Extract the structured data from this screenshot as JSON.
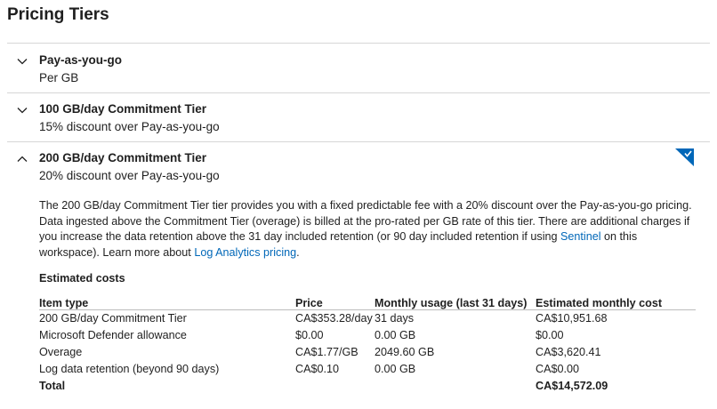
{
  "page": {
    "title": "Pricing Tiers"
  },
  "tiers": [
    {
      "name": "Pay-as-you-go",
      "subtitle": "Per GB",
      "expanded": false,
      "chevron": "chevron-down-icon"
    },
    {
      "name": "100 GB/day Commitment Tier",
      "subtitle": "15% discount over Pay-as-you-go",
      "expanded": false,
      "chevron": "chevron-down-icon"
    },
    {
      "name": "200 GB/day Commitment Tier",
      "subtitle": "20% discount over Pay-as-you-go",
      "expanded": true,
      "selected": true,
      "chevron": "chevron-up-icon"
    }
  ],
  "selected_tier": {
    "description": {
      "part1": "The 200 GB/day Commitment Tier tier provides you with a fixed predictable fee with a 20% discount over the Pay-as-you-go pricing. Data ingested above the Commitment Tier (overage) is billed at the pro-rated per GB rate of this tier. There are additional charges if you increase the data retention above the 31 day included retention (or 90 day included retention if using ",
      "sentinel_link": "Sentinel",
      "part2": " on this workspace). Learn more about ",
      "pricing_link": "Log Analytics pricing",
      "part3": "."
    },
    "estimated_costs": {
      "title": "Estimated costs",
      "headers": [
        "Item type",
        "Price",
        "Monthly usage (last 31 days)",
        "Estimated monthly cost"
      ],
      "rows": [
        [
          "200 GB/day Commitment Tier",
          "CA$353.28/day",
          "31 days",
          "CA$10,951.68"
        ],
        [
          "Microsoft Defender allowance",
          "$0.00",
          "0.00 GB",
          "$0.00"
        ],
        [
          "Overage",
          "CA$1.77/GB",
          "2049.60 GB",
          "CA$3,620.41"
        ],
        [
          "Log data retention (beyond 90 days)",
          "CA$0.10",
          "0.00 GB",
          "CA$0.00"
        ]
      ],
      "total": {
        "label": "Total",
        "value": "CA$14,572.09"
      }
    }
  },
  "colors": {
    "accent": "#0067b8",
    "text": "#1f1f1f",
    "divider": "#d6d6d6"
  }
}
